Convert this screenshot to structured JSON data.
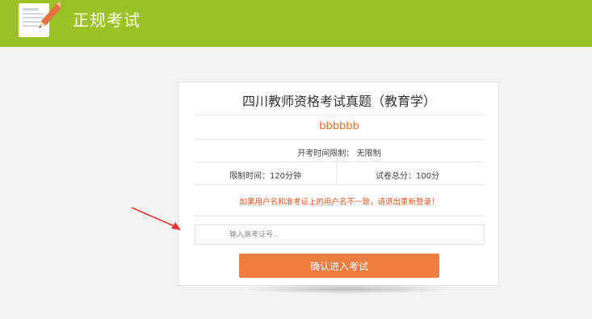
{
  "header": {
    "title": "正规考试",
    "logo_icon": "notepad-pencil-icon"
  },
  "exam": {
    "title": "四川教师资格考试真题（教育学）",
    "username": "bbbbbb",
    "start_limit": "开考时间限制： 无限制",
    "time_limit": "限制时间：120分钟",
    "total_score": "试卷总分：100分",
    "warning_prefix": "如果用户名和准考证上的用户名不一致，请退出",
    "relogin_link": "重新登录",
    "warning_suffix": "！"
  },
  "ticket_input": {
    "placeholder": "输入准考证号...",
    "value": ""
  },
  "confirm_button": {
    "label": "确认进入考试"
  },
  "colors": {
    "header_bg": "#9bc225",
    "accent_orange": "#ee7d41",
    "warning_red": "#e8541e",
    "annotation_arrow": "#e53935"
  },
  "annotation": {
    "icon": "red-arrow-icon"
  }
}
